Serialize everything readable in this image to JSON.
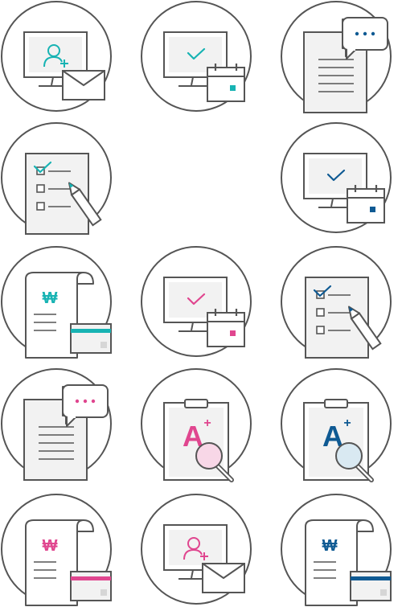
{
  "palette": {
    "stroke": "#555555",
    "fill_light": "#f2f2f2",
    "fill_white": "#ffffff",
    "teal": "#17b3b3",
    "navy": "#0f5a93",
    "pink": "#e0468f",
    "pink_light": "#f8d7e7",
    "blue_light": "#d9e9f2",
    "card_chip": "#d6d6d6"
  },
  "icons": [
    {
      "type": "monitor-user-mail",
      "accent": "teal",
      "name": "monitor-user-mail-icon"
    },
    {
      "type": "monitor-check-calendar",
      "accent": "teal",
      "name": "monitor-check-calendar-icon"
    },
    {
      "type": "document-chat",
      "accent": "navy",
      "name": "document-chat-icon"
    },
    {
      "type": "checklist-pencil",
      "accent": "teal",
      "name": "checklist-pencil-icon"
    },
    {
      "type": "empty",
      "accent": "teal",
      "name": "empty-slot"
    },
    {
      "type": "monitor-check-calendar",
      "accent": "navy",
      "name": "monitor-check-calendar-icon"
    },
    {
      "type": "receipt-card",
      "accent": "teal",
      "name": "won-receipt-card-icon",
      "symbol": "₩"
    },
    {
      "type": "monitor-check-calendar",
      "accent": "pink",
      "name": "monitor-check-calendar-icon"
    },
    {
      "type": "checklist-pencil",
      "accent": "navy",
      "name": "checklist-pencil-icon"
    },
    {
      "type": "document-chat",
      "accent": "pink",
      "name": "document-chat-icon"
    },
    {
      "type": "clipboard-grade",
      "accent": "pink",
      "name": "grade-a-plus-clipboard-icon",
      "grade": "A",
      "sup": "+"
    },
    {
      "type": "clipboard-grade",
      "accent": "navy",
      "name": "grade-a-plus-clipboard-icon",
      "grade": "A",
      "sup": "+"
    },
    {
      "type": "receipt-card",
      "accent": "pink",
      "name": "won-receipt-card-icon",
      "symbol": "₩"
    },
    {
      "type": "monitor-user-mail",
      "accent": "pink",
      "name": "monitor-user-mail-icon"
    },
    {
      "type": "receipt-card",
      "accent": "navy",
      "name": "won-receipt-card-icon",
      "symbol": "₩"
    }
  ]
}
